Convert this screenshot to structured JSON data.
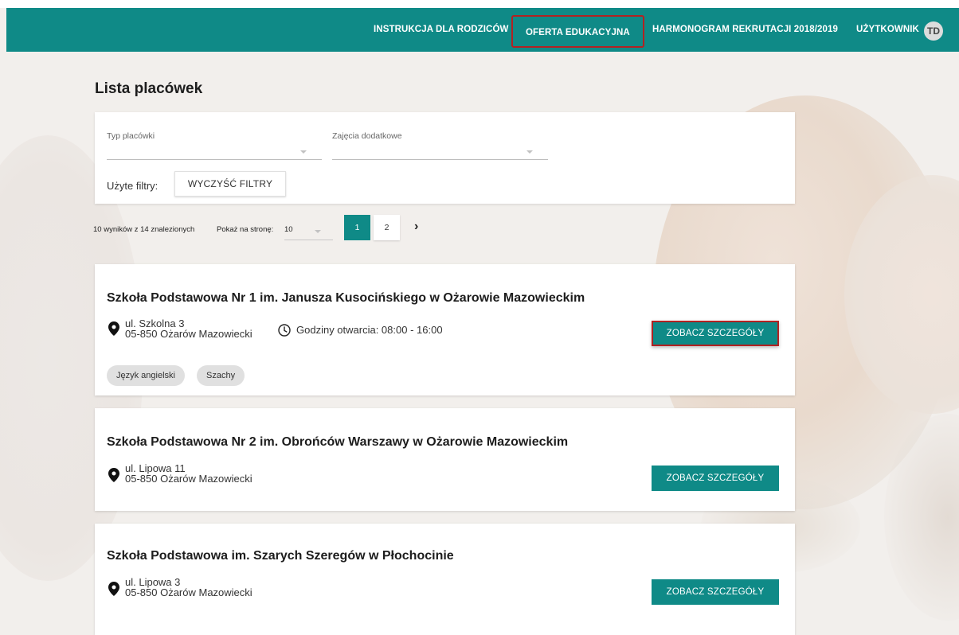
{
  "nav": {
    "items": [
      "INSTRUKCJA DLA RODZICÓW",
      "OFERTA EDUKACYJNA",
      "HARMONOGRAM REKRUTACJI 2018/2019",
      "UŻYTKOWNIK"
    ],
    "avatar_initials": "TD"
  },
  "page_title": "Lista placówek",
  "filters": {
    "type_label": "Typ placówki",
    "extra_label": "Zajęcia dodatkowe",
    "used_label": "Użyte filtry:",
    "clear_label": "WYCZYŚĆ FILTRY"
  },
  "results": {
    "summary": "10 wyników z 14 znalezionych",
    "per_page_label": "Pokaż na stronę:",
    "per_page_value": "10",
    "pages": [
      "1",
      "2"
    ],
    "next_icon": "chevron-right-icon"
  },
  "schools": [
    {
      "name": "Szkoła Podstawowa Nr 1 im. Janusza Kusocińskiego w Ożarowie Mazowieckim",
      "street": "ul. Szkolna 3",
      "city": "05-850 Ożarów Mazowiecki",
      "hours": "Godziny otwarcia: 08:00 - 16:00",
      "button": "ZOBACZ SZCZEGÓŁY",
      "tags": [
        "Język angielski",
        "Szachy"
      ]
    },
    {
      "name": "Szkoła Podstawowa Nr 2 im. Obrońców Warszawy w Ożarowie Mazowieckim",
      "street": "ul. Lipowa 11",
      "city": "05-850 Ożarów Mazowiecki",
      "button": "ZOBACZ SZCZEGÓŁY"
    },
    {
      "name": "Szkoła Podstawowa im. Szarych Szeregów w Płochocinie",
      "street": "ul. Lipowa 3",
      "city": "05-850 Ożarów Mazowiecki",
      "button": "ZOBACZ SZCZEGÓŁY"
    }
  ],
  "colors": {
    "primary": "#0f8a87",
    "highlight": "#b22222"
  }
}
